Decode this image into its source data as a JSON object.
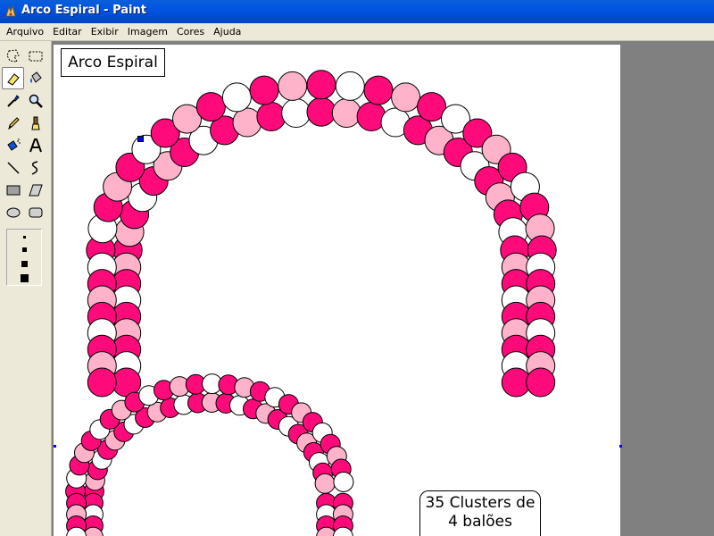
{
  "window": {
    "title": "Arco Espiral - Paint"
  },
  "menu": {
    "items": [
      "Arquivo",
      "Editar",
      "Exibir",
      "Imagem",
      "Cores",
      "Ajuda"
    ]
  },
  "tools": [
    {
      "name": "free-select-tool-icon"
    },
    {
      "name": "rect-select-tool-icon"
    },
    {
      "name": "eraser-tool-icon",
      "selected": true
    },
    {
      "name": "fill-tool-icon"
    },
    {
      "name": "color-picker-tool-icon"
    },
    {
      "name": "magnifier-tool-icon"
    },
    {
      "name": "pencil-tool-icon"
    },
    {
      "name": "brush-tool-icon"
    },
    {
      "name": "airbrush-tool-icon"
    },
    {
      "name": "text-tool-icon"
    },
    {
      "name": "line-tool-icon"
    },
    {
      "name": "curve-tool-icon"
    },
    {
      "name": "rectangle-tool-icon"
    },
    {
      "name": "polygon-tool-icon"
    },
    {
      "name": "ellipse-tool-icon"
    },
    {
      "name": "rounded-rect-tool-icon"
    }
  ],
  "canvas": {
    "title_label": "Arco Espiral",
    "clusters_label": {
      "line1": "35 Clusters de",
      "line2": "4 balões"
    }
  },
  "colors": {
    "balloon_pink": "#ff0a7a",
    "balloon_light_pink": "#ffb3cb",
    "balloon_white": "#ffffff",
    "title_bar": "#0054e3",
    "workspace": "#808080"
  }
}
